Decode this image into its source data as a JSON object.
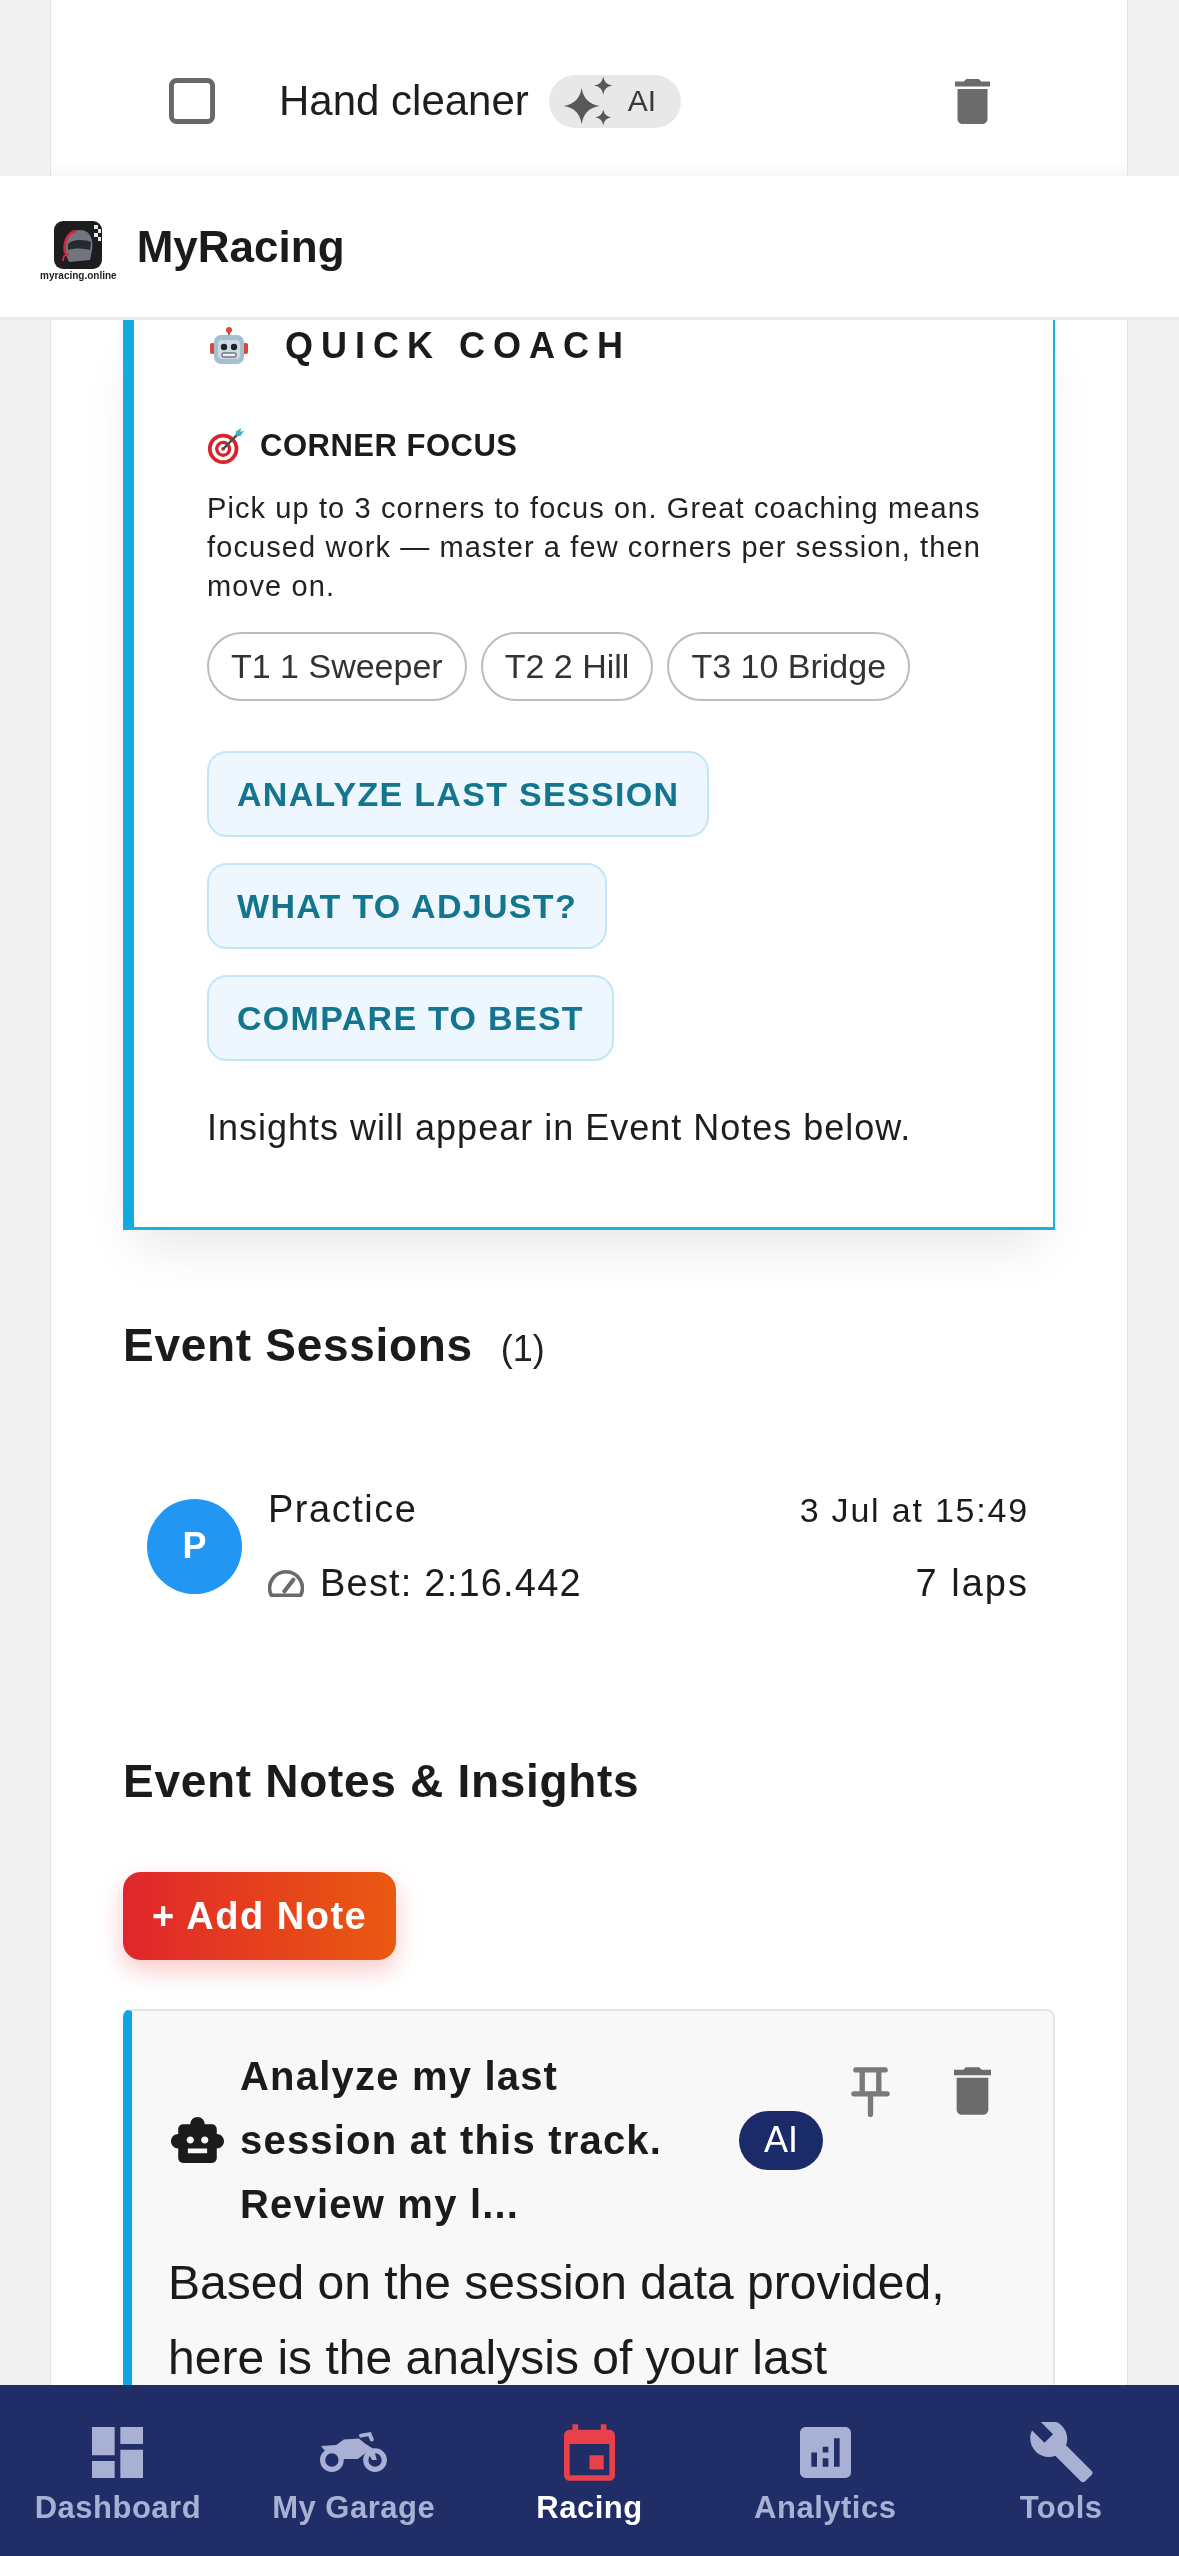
{
  "todo_item": {
    "checked": false,
    "label": "Hand cleaner",
    "badge": "AI"
  },
  "header": {
    "logo_caption": "myracing.online",
    "title": "MyRacing"
  },
  "quick_coach": {
    "title": "QUICK COACH",
    "section_title": "CORNER FOCUS",
    "description": "Pick up to 3 corners to focus on. Great coaching means focused work — master a few corners per session, then move on.",
    "corners": [
      {
        "label": "T1 1 Sweeper",
        "selected": false
      },
      {
        "label": "T2 2 Hill",
        "selected": false
      },
      {
        "label": "T3 10 Bridge",
        "selected": false
      }
    ],
    "actions": [
      "ANALYZE LAST SESSION",
      "WHAT TO ADJUST?",
      "COMPARE TO BEST"
    ],
    "footnote": "Insights will appear in Event Notes below."
  },
  "event_sessions": {
    "title": "Event Sessions",
    "count": "(1)",
    "sessions": [
      {
        "avatar": "P",
        "color": "#2196f3",
        "name": "Practice",
        "date": "3 Jul at 15:49",
        "best": "Best: 2:16.442",
        "laps": "7 laps"
      }
    ]
  },
  "event_notes": {
    "title": "Event Notes & Insights",
    "add_button": "+ Add Note",
    "notes": [
      {
        "title": "Analyze my last session at this track. Review my l...",
        "badge": "AI",
        "body": "Based on the session data provided, here is the analysis of your last"
      }
    ]
  },
  "bottom_nav": [
    {
      "label": "Dashboard",
      "selected": false
    },
    {
      "label": "My Garage",
      "selected": false
    },
    {
      "label": "Racing",
      "selected": true
    },
    {
      "label": "Analytics",
      "selected": false
    },
    {
      "label": "Tools",
      "selected": false
    }
  ]
}
